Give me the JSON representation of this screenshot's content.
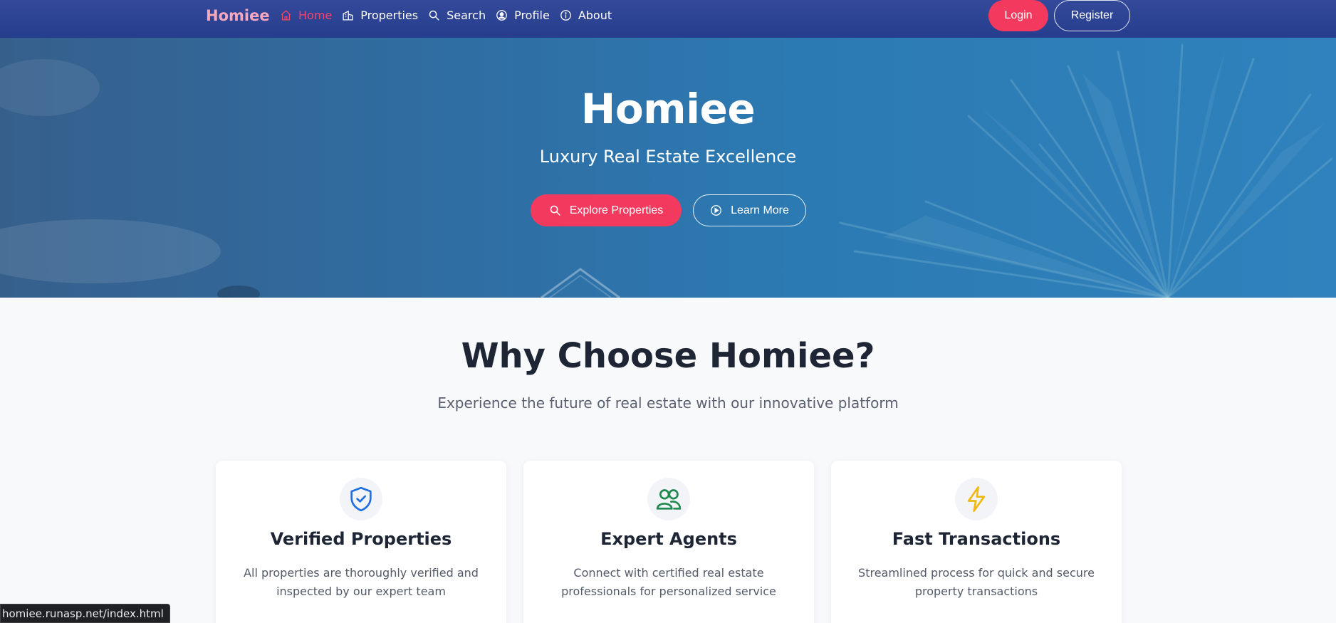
{
  "nav": {
    "brand": "Homiee",
    "links": [
      {
        "label": "Home",
        "icon": "home-icon"
      },
      {
        "label": "Properties",
        "icon": "building-icon"
      },
      {
        "label": "Search",
        "icon": "search-icon"
      },
      {
        "label": "Profile",
        "icon": "user-circle-icon"
      },
      {
        "label": "About",
        "icon": "info-icon"
      }
    ],
    "login_label": "Login",
    "register_label": "Register"
  },
  "hero": {
    "title": "Homiee",
    "subtitle": "Luxury Real Estate Excellence",
    "explore_label": "Explore Properties",
    "learn_label": "Learn More"
  },
  "why": {
    "title": "Why Choose Homiee?",
    "subtitle": "Experience the future of real estate with our innovative platform",
    "cards": [
      {
        "title": "Verified Properties",
        "text": "All properties are thoroughly verified and inspected by our expert team",
        "icon": "shield-check-icon"
      },
      {
        "title": "Expert Agents",
        "text": "Connect with certified real estate professionals for personalized service",
        "icon": "people-icon"
      },
      {
        "title": "Fast Transactions",
        "text": "Streamlined process for quick and secure property transactions",
        "icon": "lightning-icon"
      }
    ]
  },
  "status_url": "homiee.runasp.net/index.html",
  "colors": {
    "navbar": "#2e4494",
    "accent": "#f4395e",
    "hero": "#2f77b0",
    "shield": "#1f6fe0",
    "people": "#1f8a4e",
    "lightning": "#f2b80f"
  }
}
